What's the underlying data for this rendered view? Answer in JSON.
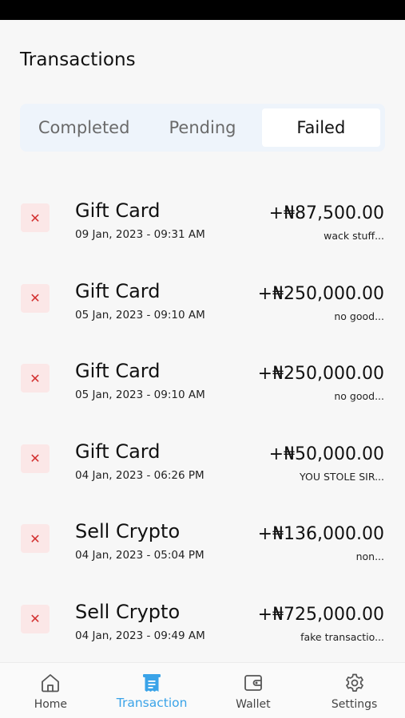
{
  "header": {
    "title": "Transactions"
  },
  "tabs": [
    {
      "label": "Completed",
      "active": false
    },
    {
      "label": "Pending",
      "active": false
    },
    {
      "label": "Failed",
      "active": true
    }
  ],
  "transactions": [
    {
      "title": "Gift Card",
      "date": "09 Jan, 2023 - 09:31 AM",
      "amount": "+₦87,500.00",
      "note": "wack stuff...",
      "status_icon": "close-icon"
    },
    {
      "title": "Gift Card",
      "date": "05 Jan, 2023 - 09:10 AM",
      "amount": "+₦250,000.00",
      "note": "no good...",
      "status_icon": "close-icon"
    },
    {
      "title": "Gift Card",
      "date": "05 Jan, 2023 - 09:10 AM",
      "amount": "+₦250,000.00",
      "note": "no good...",
      "status_icon": "close-icon"
    },
    {
      "title": "Gift Card",
      "date": "04 Jan, 2023 - 06:26 PM",
      "amount": "+₦50,000.00",
      "note": "YOU STOLE SIR...",
      "status_icon": "close-icon"
    },
    {
      "title": "Sell Crypto",
      "date": "04 Jan, 2023 - 05:04 PM",
      "amount": "+₦136,000.00",
      "note": "non...",
      "status_icon": "close-icon"
    },
    {
      "title": "Sell Crypto",
      "date": "04 Jan, 2023 - 09:49 AM",
      "amount": "+₦725,000.00",
      "note": "fake transactio...",
      "status_icon": "close-icon"
    }
  ],
  "nav": [
    {
      "label": "Home",
      "icon": "home-icon",
      "active": false
    },
    {
      "label": "Transaction",
      "icon": "receipt-icon",
      "active": true
    },
    {
      "label": "Wallet",
      "icon": "wallet-icon",
      "active": false
    },
    {
      "label": "Settings",
      "icon": "gear-icon",
      "active": false
    }
  ],
  "colors": {
    "accent": "#3aa3e8",
    "failed": "#d32f2f",
    "failed_bg": "#fbe7e7",
    "tab_bg": "#eef4fb"
  }
}
